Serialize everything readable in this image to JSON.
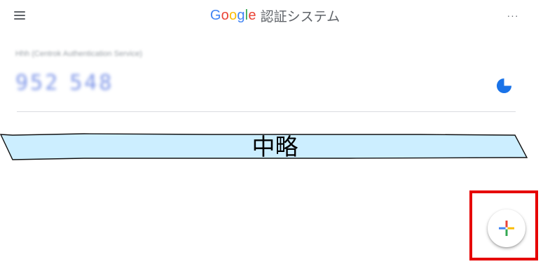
{
  "header": {
    "menu_icon": "hamburger-menu-icon",
    "logo_letters": [
      {
        "ch": "G",
        "color": "#4285F4"
      },
      {
        "ch": "o",
        "color": "#EA4335"
      },
      {
        "ch": "o",
        "color": "#FBBC05"
      },
      {
        "ch": "g",
        "color": "#4285F4"
      },
      {
        "ch": "l",
        "color": "#34A853"
      },
      {
        "ch": "e",
        "color": "#EA4335"
      }
    ],
    "title": "認証システム",
    "more_icon": "more-options-icon",
    "more_label": "···"
  },
  "account": {
    "issuer": "Hhh (Centrok Authentication Service)",
    "code_part1": "952",
    "code_part2": "548",
    "timer_icon": "countdown-pie-icon",
    "timer_remaining_fraction": 0.75,
    "code_color": "#7d95e8",
    "timer_color": "#1a73e8"
  },
  "omission": {
    "label": "中略",
    "fill": "#cceeff"
  },
  "fab": {
    "icon": "add-plus-icon",
    "plus_colors": {
      "top": "#EA4335",
      "left": "#4285F4",
      "right": "#FBBC05",
      "bottom": "#34A853"
    }
  },
  "annotation": {
    "highlight_color": "#e60000"
  }
}
